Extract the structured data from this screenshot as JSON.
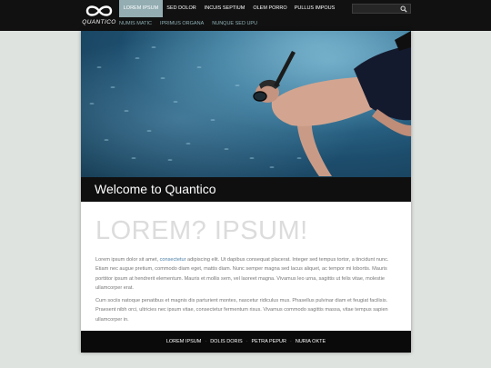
{
  "brand": {
    "name": "QUANTICO"
  },
  "main_nav": [
    {
      "label": "LOREM IPSUM",
      "active": true
    },
    {
      "label": "SED DOLOR",
      "active": false
    },
    {
      "label": "INCUIS SEPTIUM",
      "active": false
    },
    {
      "label": "OLEM PORRO",
      "active": false
    },
    {
      "label": "PULLUS IMPOUS",
      "active": false
    }
  ],
  "sub_nav": [
    "NUMIS MATIC",
    "IPRIMUS ORGANA",
    "NUNQUE SED UPU"
  ],
  "search": {
    "placeholder": "",
    "icon": "search-icon"
  },
  "hero": {
    "welcome": "Welcome to Quantico"
  },
  "content": {
    "headline": "LOREM? IPSUM!",
    "p1_before_link": "Lorem ipsum dolor sit amet, ",
    "p1_link": "consectetur",
    "p1_after_link": " adipiscing elit. Ut dapibus consequat placerat. Integer sed tempus tortor, a tincidunt nunc. Etiam nec augue pretium, commodo diam eget, mattis diam. Nunc semper magna sed lacus aliquet, ac tempor mi lobortis. Mauris porttitor ipsum at hendrerit elementum. Mauris et mollis sem, vel laoreet magna. Vivamus leo urna, sagittis ut felis vitae, molestie ullamcorper erat.",
    "p2": "Cum sociis natoque penatibus et magnis dis parturient montes, nascetur ridiculus mus. Phasellus pulvinar diam et feugiat facilisis. Praesent nibh orci, ultricies nec ipsum vitae, consectetur fermentum risus. Vivamus commodo sagittis massa, vitae tempus sapien ullamcorper in."
  },
  "footer": {
    "links": [
      "LOREM IPSUM",
      "DOLIS DORIS",
      "PETRA PEPUR",
      "NURIA OKTE"
    ]
  },
  "colors": {
    "active_nav": "#93adb2",
    "sub_nav_text": "#8fb0b5",
    "link": "#4a7fa6"
  }
}
